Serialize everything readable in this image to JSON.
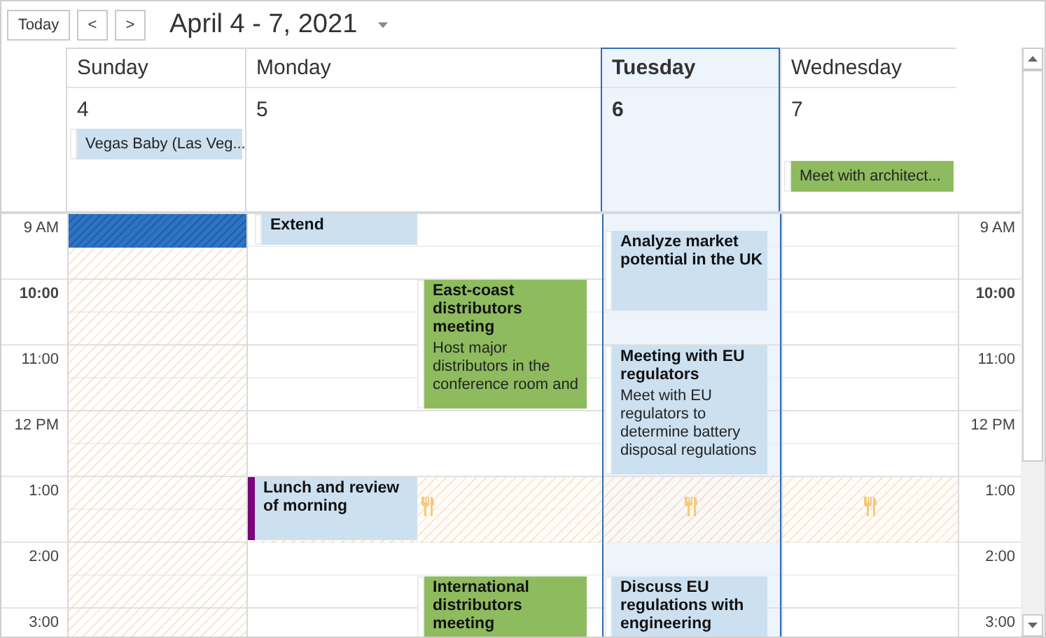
{
  "toolbar": {
    "today": "Today",
    "prev": "<",
    "next": ">",
    "range": "April 4 - 7, 2021"
  },
  "days": [
    {
      "name": "Sunday",
      "date": "4",
      "selected": false,
      "workday": false,
      "cell_selected": true,
      "all_day_events": [
        {
          "title": "Vegas Baby (Las Veg...",
          "color": "#cce0f0"
        }
      ]
    },
    {
      "name": "Monday",
      "date": "5",
      "selected": false,
      "workday": true,
      "cell_selected": false,
      "events": [
        {
          "title": "Extend",
          "color": "#cce0f0",
          "out_of_office": false
        },
        {
          "title": "East-coast distributors meeting",
          "description": "Host major distributors in the conference room and",
          "color": "#8fbb5f",
          "out_of_office": false
        },
        {
          "title": "Lunch and review of morning",
          "color": "#cce0f0",
          "out_of_office": true
        },
        {
          "title": "International distributors meeting",
          "color": "#8fbb5f",
          "out_of_office": false
        }
      ]
    },
    {
      "name": "Tuesday",
      "date": "6",
      "selected": true,
      "workday": true,
      "cell_selected": false,
      "events": [
        {
          "title": "Analyze market potential in the UK",
          "color": "#cce0f0",
          "out_of_office": false
        },
        {
          "title": "Meeting with EU regulators",
          "description": "Meet with EU regulators to determine battery disposal regulations",
          "color": "#cce0f0",
          "out_of_office": false
        },
        {
          "title": "Discuss EU regulations with engineering",
          "color": "#cce0f0",
          "out_of_office": false
        }
      ]
    },
    {
      "name": "Wednesday",
      "date": "7",
      "selected": false,
      "workday": true,
      "cell_selected": false,
      "all_day_events": [
        {
          "title": "Meet with architect...",
          "color": "#8fbb5f"
        }
      ]
    }
  ],
  "time_rulers": [
    {
      "labels": [
        {
          "text": "9 AM",
          "current": false
        },
        {
          "text": "10:00",
          "current": true
        },
        {
          "text": "11:00",
          "current": false
        },
        {
          "text": "12 PM",
          "current": false
        },
        {
          "text": "1:00",
          "current": false
        },
        {
          "text": "2:00",
          "current": false
        },
        {
          "text": "3:00",
          "current": false
        }
      ]
    },
    {
      "labels": [
        {
          "text": "9 AM",
          "current": false
        },
        {
          "text": "10:00",
          "current": true
        },
        {
          "text": "11:00",
          "current": false
        },
        {
          "text": "12 PM",
          "current": false
        },
        {
          "text": "1:00",
          "current": false
        },
        {
          "text": "2:00",
          "current": false
        },
        {
          "text": "3:00",
          "current": false
        }
      ]
    }
  ]
}
